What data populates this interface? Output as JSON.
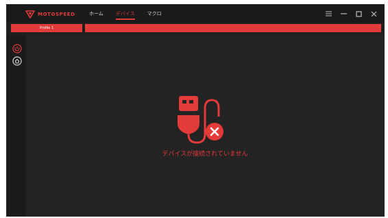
{
  "app": {
    "logo_text": "MOTOSPEED"
  },
  "nav": {
    "items": [
      {
        "label": "ホーム"
      },
      {
        "label": "デバイス"
      },
      {
        "label": "マクロ"
      }
    ]
  },
  "window_controls": {
    "icons": [
      "menu-icon",
      "minimize-icon",
      "maximize-icon",
      "close-icon"
    ]
  },
  "profile": {
    "tab_label": "Profile 1"
  },
  "sidebar": {
    "icons": [
      "power-icon",
      "home-icon"
    ]
  },
  "main": {
    "status": "デバイスが接続されていません",
    "illustration_icon": "usb-disconnected-icon"
  },
  "colors": {
    "accent": "#e33a3a",
    "background": "#232323",
    "titlebar": "#1a1a1a"
  }
}
